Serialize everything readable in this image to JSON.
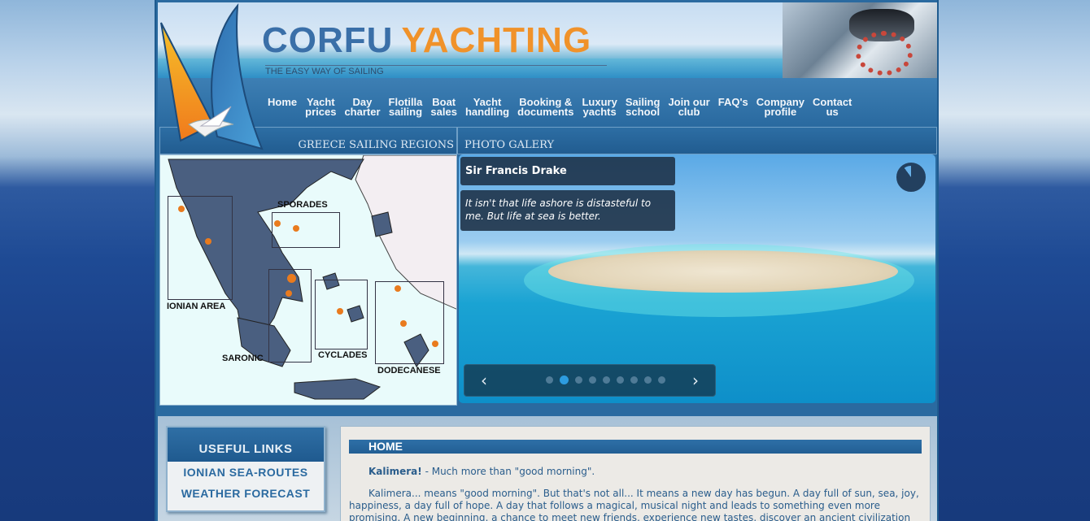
{
  "header": {
    "brand_word1": "CORFU",
    "brand_word2": "YACHTING",
    "tagline": "THE EASY WAY OF SAILING"
  },
  "nav": {
    "items": [
      {
        "label": "Home"
      },
      {
        "label": "Yacht\nprices"
      },
      {
        "label": "Day\ncharter"
      },
      {
        "label": "Flotilla\nsailing"
      },
      {
        "label": "Boat\nsales"
      },
      {
        "label": "Yacht\nhandling"
      },
      {
        "label": "Booking &\ndocuments"
      },
      {
        "label": "Luxury\nyachts"
      },
      {
        "label": "Sailing\nschool"
      },
      {
        "label": "Join our\nclub"
      },
      {
        "label": "FAQ's"
      },
      {
        "label": "Company\nprofile"
      },
      {
        "label": "Contact\nus"
      }
    ]
  },
  "regions": {
    "title": "GREECE SAILING REGIONS",
    "labels": {
      "ionian": "IONIAN AREA",
      "sporades": "SPORADES",
      "saronic": "SARONIC",
      "cyclades": "CYCLADES",
      "dodecanese": "DODECANESE"
    }
  },
  "gallery": {
    "title": "PHOTO GALERY",
    "caption_title": "Sir Francis Drake",
    "caption_text": "It isn't that life ashore is distasteful to me. But life at sea is better.",
    "prev_icon": "chevron-left-icon",
    "next_icon": "chevron-right-icon",
    "slide_count": 9,
    "active_slide": 2
  },
  "useful_links": {
    "title": "USEFUL LINKS",
    "items": [
      {
        "label": "IONIAN SEA-ROUTES"
      },
      {
        "label": "WEATHER FORECAST"
      }
    ]
  },
  "content": {
    "title": "HOME",
    "p1_bold": "Kalimera!",
    "p1_rest": " - Much more than \"good morning\".",
    "p2": "Kalimera... means \"good morning\". But that's not all... It means a new day has begun. A day full of sun, sea, joy, happiness, a day full of hope. A day that follows a magical, musical night and leads to something even more promising. A new beginning, a chance to meet new friends, experience new tastes, discover an ancient civilization and"
  },
  "colors": {
    "brand_blue": "#3a6fa8",
    "brand_orange": "#f0922a",
    "nav_bg": "#2a6aa0",
    "link_blue": "#2b6aa0",
    "region_dot": "#e97b1e"
  }
}
